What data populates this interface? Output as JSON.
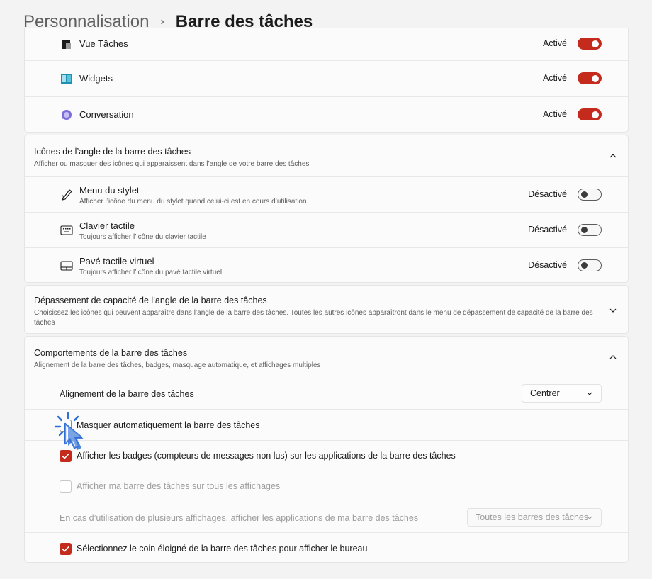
{
  "breadcrumb": {
    "parent": "Personnalisation",
    "separator": "›",
    "current": "Barre des tâches"
  },
  "taskbar_items": [
    {
      "name": "Vue Tâches",
      "state": "Activé",
      "on": true
    },
    {
      "name": "Widgets",
      "state": "Activé",
      "on": true
    },
    {
      "name": "Conversation",
      "state": "Activé",
      "on": true
    }
  ],
  "corner_icons": {
    "title": "Icônes de l’angle de la barre des tâches",
    "subtitle": "Afficher ou masquer des icônes qui apparaissent dans l’angle de votre barre des tâches",
    "items": [
      {
        "title": "Menu du stylet",
        "subtitle": "Afficher l’icône du menu du stylet quand celui-ci est en cours d’utilisation",
        "state": "Désactivé"
      },
      {
        "title": "Clavier tactile",
        "subtitle": "Toujours afficher l’icône du clavier tactile",
        "state": "Désactivé"
      },
      {
        "title": "Pavé tactile virtuel",
        "subtitle": "Toujours afficher l’icône du pavé tactile virtuel",
        "state": "Désactivé"
      }
    ]
  },
  "overflow": {
    "title": "Dépassement de capacité de l’angle de la barre des tâches",
    "subtitle": "Choisissez les icônes qui peuvent apparaître dans l’angle de la barre des tâches. Toutes les autres icônes apparaîtront dans le menu de dépassement de capacité de la barre des tâches"
  },
  "behaviors": {
    "title": "Comportements de la barre des tâches",
    "subtitle": "Alignement de la barre des tâches, badges, masquage automatique, et affichages multiples",
    "alignment_label": "Alignement de la barre des tâches",
    "alignment_value": "Centrer",
    "autohide_label": "Masquer automatiquement la barre des tâches",
    "badges_label": "Afficher les badges (compteurs de messages non lus) sur les applications de la barre des tâches",
    "all_displays_label": "Afficher ma barre des tâches sur tous les affichages",
    "multi_display_label": "En cas d’utilisation de plusieurs affichages, afficher les applications de ma barre des tâches",
    "multi_display_value": "Toutes les barres des tâches",
    "far_corner_label": "Sélectionnez le coin éloigné de la barre des tâches pour afficher le bureau"
  },
  "colors": {
    "accent": "#c42b1c",
    "cursor": "#2f6fd6"
  }
}
